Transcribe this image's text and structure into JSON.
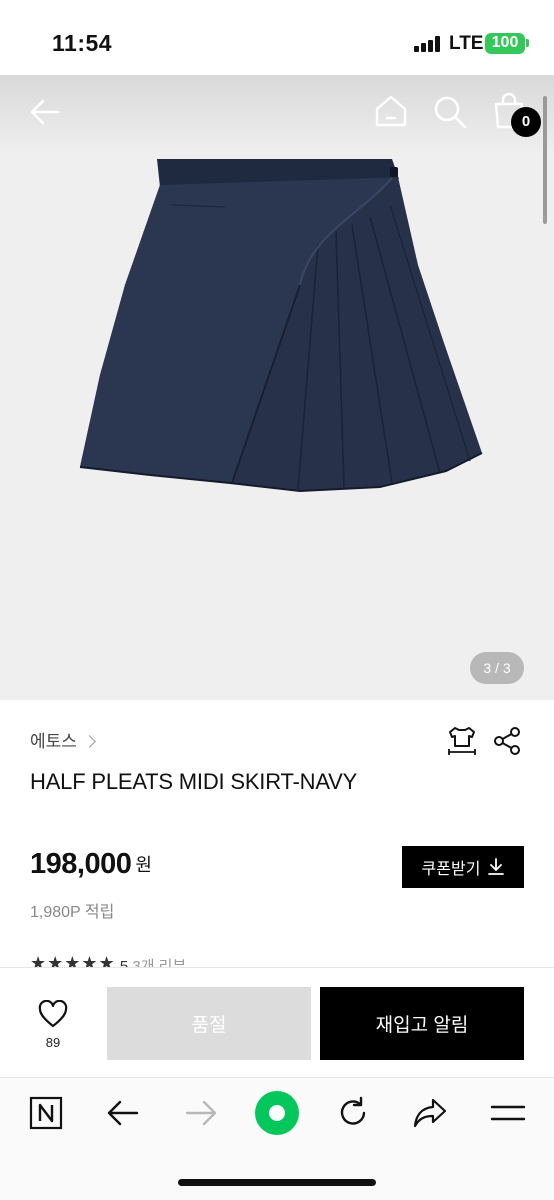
{
  "status_bar": {
    "time": "11:54",
    "network": "LTE",
    "battery": "100"
  },
  "top_nav": {
    "back_icon": "back-arrow-icon",
    "home_icon": "home-icon",
    "search_icon": "search-icon",
    "cart_icon": "shopping-bag-icon",
    "cart_count": "0"
  },
  "gallery": {
    "pager": "3 / 3"
  },
  "product": {
    "brand": "에토스",
    "title": "HALF PLEATS MIDI SKIRT-NAVY",
    "price": "198,000",
    "currency": "원",
    "points": "1,980P 적립",
    "coupon_label": "쿠폰받기",
    "review_stars": "★★★★★",
    "review_score": "5",
    "review_count": "3개 리뷰"
  },
  "actions": {
    "like_count": "89",
    "soldout_label": "품절",
    "restock_label": "재입고 알림"
  },
  "browser_toolbar": {
    "items": [
      "naver-icon",
      "back-icon",
      "forward-icon",
      "green-dot-icon",
      "reload-icon",
      "share-icon",
      "menu-icon"
    ],
    "accent": "#03c75a"
  },
  "colors": {
    "skirt": "#27324a",
    "accent_green": "#03c75a",
    "battery_green": "#34c759"
  }
}
